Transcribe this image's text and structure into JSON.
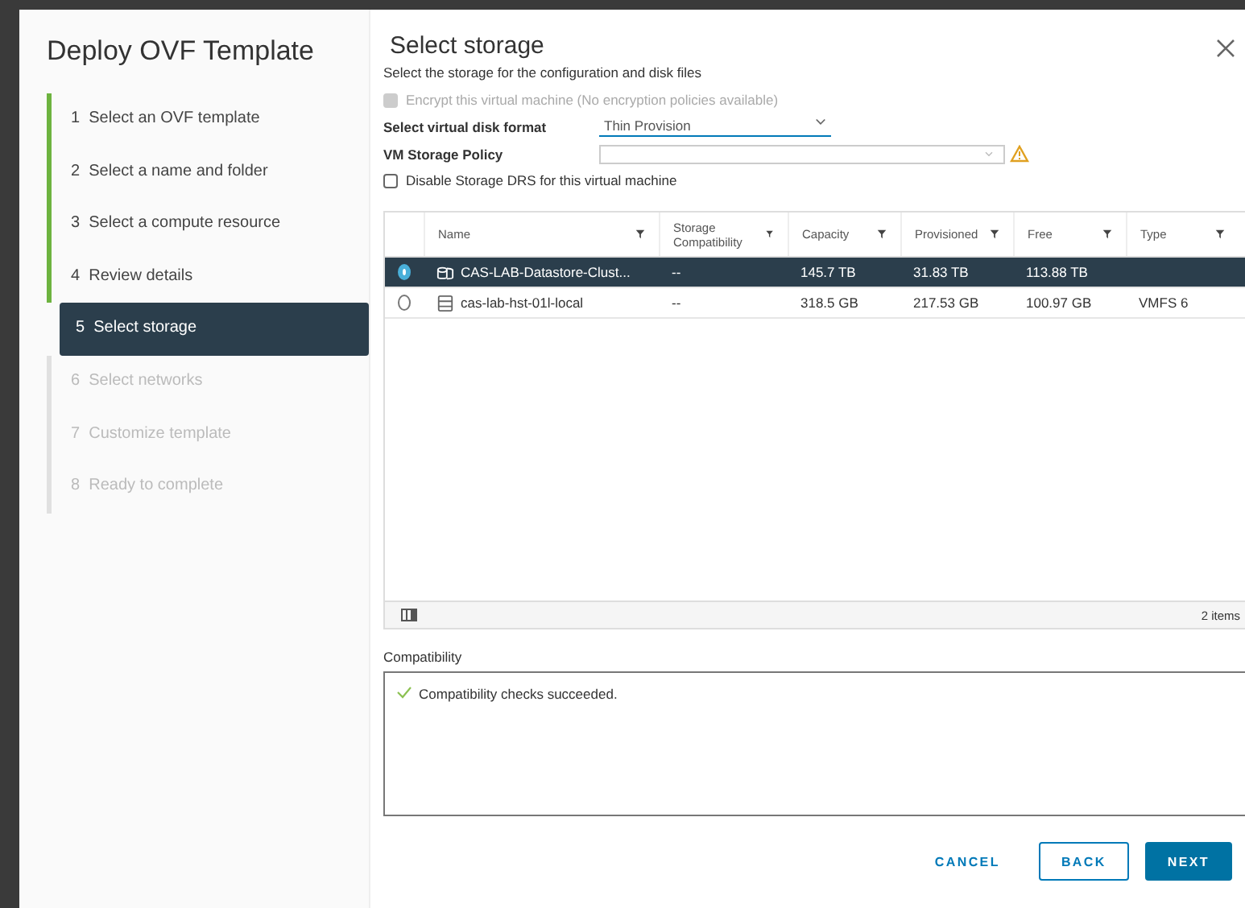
{
  "wizard": {
    "title": "Deploy OVF Template",
    "steps": [
      {
        "number": "1",
        "label": "Select an OVF template",
        "completed": true,
        "selected": false,
        "disabled": false
      },
      {
        "number": "2",
        "label": "Select a name and folder",
        "completed": true,
        "selected": false,
        "disabled": false
      },
      {
        "number": "3",
        "label": "Select a compute resource",
        "completed": true,
        "selected": false,
        "disabled": false
      },
      {
        "number": "4",
        "label": "Review details",
        "completed": true,
        "selected": false,
        "disabled": false
      },
      {
        "number": "5",
        "label": "Select storage",
        "completed": false,
        "selected": true,
        "disabled": false
      },
      {
        "number": "6",
        "label": "Select networks",
        "completed": false,
        "selected": false,
        "disabled": true
      },
      {
        "number": "7",
        "label": "Customize template",
        "completed": false,
        "selected": false,
        "disabled": true
      },
      {
        "number": "8",
        "label": "Ready to complete",
        "completed": false,
        "selected": false,
        "disabled": true
      }
    ]
  },
  "page": {
    "title": "Select storage",
    "subtitle": "Select the storage for the configuration and disk files",
    "encrypt": {
      "label": "Encrypt this virtual machine (No encryption policies available)",
      "checked": false,
      "disabled": true
    },
    "disk_format": {
      "label": "Select virtual disk format",
      "value": "Thin Provision"
    },
    "storage_policy": {
      "label": "VM Storage Policy",
      "warning": true
    },
    "disable_drs": {
      "label": "Disable Storage DRS for this virtual machine",
      "checked": false,
      "disabled": false
    }
  },
  "table": {
    "columns": [
      "Name",
      "Storage Compatibility",
      "Capacity",
      "Provisioned",
      "Free",
      "Type"
    ],
    "rows": [
      {
        "selected": true,
        "kind": "cluster",
        "cells": [
          "CAS-LAB-Datastore-Clust...",
          "--",
          "145.7 TB",
          "31.83 TB",
          "113.88 TB",
          ""
        ]
      },
      {
        "selected": false,
        "kind": "datastore",
        "cells": [
          "cas-lab-hst-01l-local",
          "--",
          "318.5 GB",
          "217.53 GB",
          "100.97 GB",
          "VMFS 6"
        ]
      }
    ],
    "footer": "2 items"
  },
  "compatibility": {
    "label": "Compatibility",
    "message": "Compatibility checks succeeded.",
    "ok": true
  },
  "buttons": [
    {
      "label": "CANCEL",
      "kind": "flat"
    },
    {
      "label": "BACK",
      "kind": "outline"
    },
    {
      "label": "NEXT",
      "kind": "primary"
    }
  ]
}
